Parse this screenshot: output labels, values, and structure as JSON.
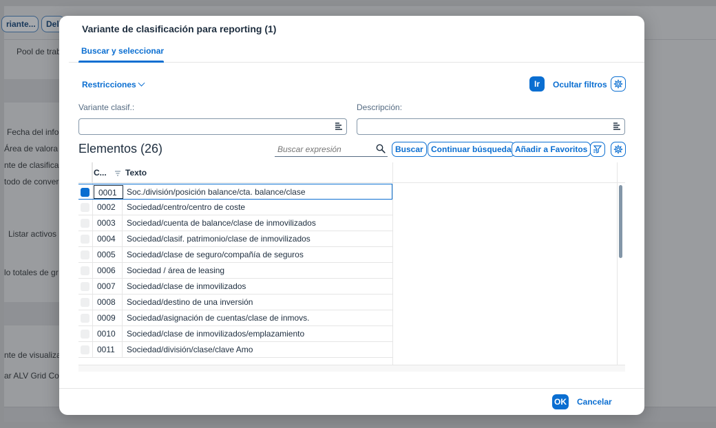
{
  "background": {
    "toolbar_buttons": [
      "riante...",
      "Delin"
    ],
    "labels": [
      "Pool de trab",
      "Fecha del info",
      "Área de valora",
      "nte de clasifica",
      "todo de convers",
      "Listar activos",
      "lo totales de gr",
      "nte de visualiza",
      "ar ALV Grid Co"
    ]
  },
  "dialog": {
    "title": "Variante de clasificación para reporting (1)",
    "tab": "Buscar y seleccionar",
    "restrictions_label": "Restricciones",
    "go_button": "Ir",
    "hide_filters": "Ocultar filtros",
    "filters": {
      "variant_label": "Variante clasif.:",
      "variant_value": "",
      "description_label": "Descripción:",
      "description_value": ""
    },
    "elements_title": "Elementos (26)",
    "search_placeholder": "Buscar expresión",
    "buttons": {
      "search": "Buscar",
      "continue_search": "Continuar búsqueda",
      "add_favorites": "Añadir a Favoritos"
    },
    "table": {
      "columns": [
        "C...",
        "Texto"
      ],
      "rows": [
        {
          "code": "0001",
          "text": "Soc./división/posición balance/cta. balance/clase",
          "selected": true
        },
        {
          "code": "0002",
          "text": "Sociedad/centro/centro de coste",
          "selected": false
        },
        {
          "code": "0003",
          "text": "Sociedad/cuenta de balance/clase de inmovilizados",
          "selected": false
        },
        {
          "code": "0004",
          "text": "Sociedad/clasif. patrimonio/clase de inmovilizados",
          "selected": false
        },
        {
          "code": "0005",
          "text": "Sociedad/clase de seguro/compañía de seguros",
          "selected": false
        },
        {
          "code": "0006",
          "text": "Sociedad / área de leasing",
          "selected": false
        },
        {
          "code": "0007",
          "text": "Sociedad/clase de inmovilizados",
          "selected": false
        },
        {
          "code": "0008",
          "text": "Sociedad/destino de una inversión",
          "selected": false
        },
        {
          "code": "0009",
          "text": "Sociedad/asignación de cuentas/clase de inmovs.",
          "selected": false
        },
        {
          "code": "0010",
          "text": "Sociedad/clase de inmovilizados/emplazamiento",
          "selected": false
        },
        {
          "code": "0011",
          "text": "Sociedad/división/clase/clave Amo",
          "selected": false
        }
      ]
    },
    "ok_button": "OK",
    "cancel_button": "Cancelar"
  },
  "colors": {
    "accent": "#0a6ed1",
    "text": "#1d2d3e",
    "overlay": "#8d8f92"
  }
}
